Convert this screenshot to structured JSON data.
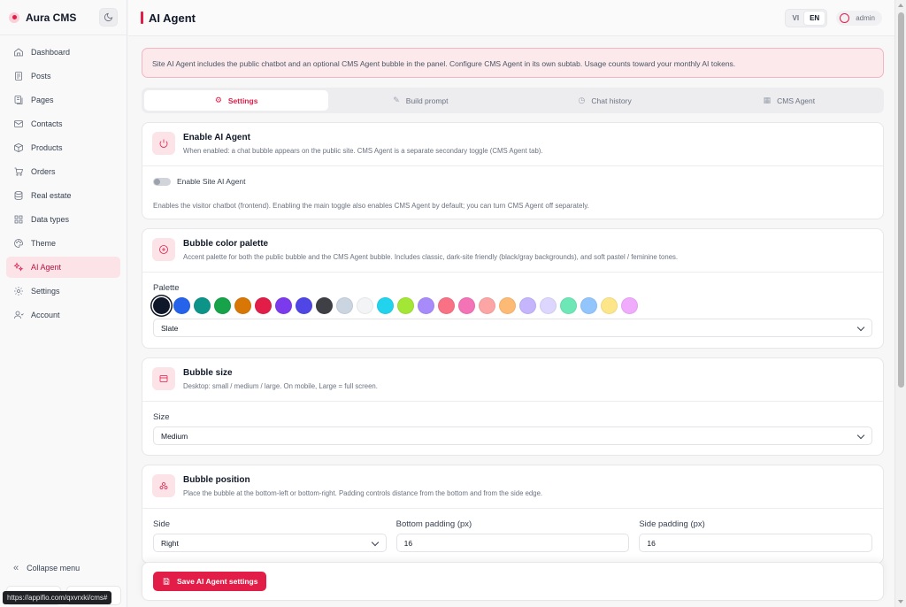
{
  "app": {
    "name": "Aura CMS"
  },
  "sidebar": {
    "items": [
      {
        "label": "Dashboard",
        "icon": "home-icon"
      },
      {
        "label": "Posts",
        "icon": "document-icon"
      },
      {
        "label": "Pages",
        "icon": "pages-icon"
      },
      {
        "label": "Contacts",
        "icon": "mail-icon"
      },
      {
        "label": "Products",
        "icon": "box-icon"
      },
      {
        "label": "Orders",
        "icon": "cart-icon"
      },
      {
        "label": "Real estate",
        "icon": "database-icon"
      },
      {
        "label": "Data types",
        "icon": "grid-icon"
      },
      {
        "label": "Theme",
        "icon": "palette-icon"
      },
      {
        "label": "AI Agent",
        "icon": "sparkle-icon",
        "active": true
      },
      {
        "label": "Settings",
        "icon": "gear-icon"
      },
      {
        "label": "Account",
        "icon": "user-icon"
      }
    ],
    "collapse_label": "Collapse menu"
  },
  "header": {
    "title": "AI Agent",
    "languages": [
      "VI",
      "EN"
    ],
    "active_language": "EN",
    "user": "admin"
  },
  "notice": "Site AI Agent includes the public chatbot and an optional CMS Agent bubble in the panel. Configure CMS Agent in its own subtab. Usage counts toward your monthly AI tokens.",
  "tabs": [
    {
      "label": "Settings",
      "icon": "gear-icon",
      "active": true
    },
    {
      "label": "Build prompt",
      "icon": "pencil-icon"
    },
    {
      "label": "Chat history",
      "icon": "clock-icon"
    },
    {
      "label": "CMS Agent",
      "icon": "grid-icon"
    }
  ],
  "enable_card": {
    "title": "Enable AI Agent",
    "subtitle": "When enabled: a chat bubble appears on the public site. CMS Agent is a separate secondary toggle (CMS Agent tab).",
    "toggle_label": "Enable Site AI Agent",
    "toggle_on": false,
    "helper": "Enables the visitor chatbot (frontend). Enabling the main toggle also enables CMS Agent by default; you can turn CMS Agent off separately."
  },
  "palette_card": {
    "title": "Bubble color palette",
    "subtitle": "Accent palette for both the public bubble and the CMS Agent bubble. Includes classic, dark-site friendly (black/gray backgrounds), and soft pastel / feminine tones.",
    "label": "Palette",
    "colors": [
      "#0f172a",
      "#2563eb",
      "#0d9488",
      "#16a34a",
      "#d97706",
      "#e11d48",
      "#7c3aed",
      "#4f46e5",
      "#3f3f46",
      "#cbd5e1",
      "#f3f4f6",
      "#22d3ee",
      "#a3e635",
      "#a78bfa",
      "#f87185",
      "#f472b6",
      "#fca5a5",
      "#fdba74",
      "#c4b5fd",
      "#ddd6fe",
      "#6ee7b7",
      "#93c5fd",
      "#fde68a",
      "#f0abfc"
    ],
    "selected_index": 0,
    "selected_name": "Slate"
  },
  "size_card": {
    "title": "Bubble size",
    "subtitle": "Desktop: small / medium / large. On mobile, Large = full screen.",
    "label": "Size",
    "value": "Medium"
  },
  "position_card": {
    "title": "Bubble position",
    "subtitle": "Place the bubble at the bottom-left or bottom-right. Padding controls distance from the bottom and from the side edge.",
    "side_label": "Side",
    "side_value": "Right",
    "bottom_label": "Bottom padding (px)",
    "bottom_value": "16",
    "sidepad_label": "Side padding (px)",
    "sidepad_value": "16"
  },
  "save_label": "Save AI Agent settings",
  "status_url": "https://appifio.com/qxvrxki/cms#"
}
